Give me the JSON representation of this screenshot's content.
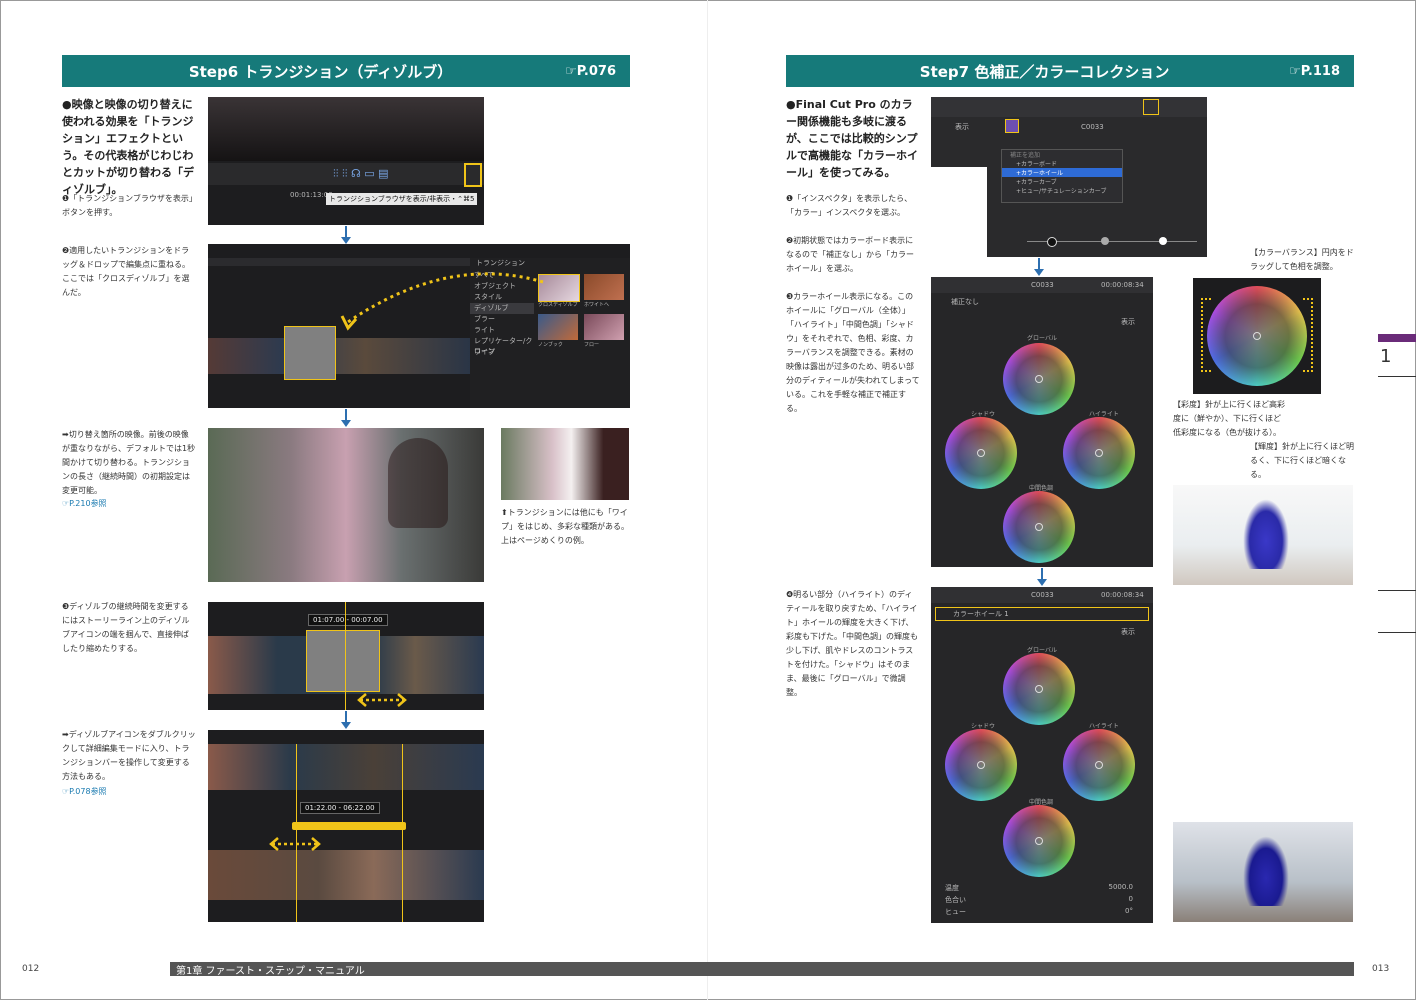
{
  "left": {
    "banner_title": "Step6 トランジション（ディゾルブ）",
    "banner_ref": "☞P.076",
    "lead": "●映像と映像の切り替えに使われる効果を「トランジション」エフェクトという。その代表格がじわじわとカットが切り替わる「ディゾルブ」。",
    "note1": "❶「トランジションブラウザを表示」ボタンを押す。",
    "tooltip": "トランジションブラウザを表示/非表示・⌃⌘5",
    "timecode1": "00:01:13:00",
    "note2": "❷適用したいトランジションをドラッグ＆ドロップで編集点に重ねる。ここでは「クロスディゾルブ」を選んだ。",
    "browser_header": "トランジション",
    "browser_items": [
      "すべて",
      "オブジェクト",
      "スタイル",
      "ディゾルブ",
      "ブラー",
      "ライト",
      "レプリケーター/クローン",
      "ワイプ"
    ],
    "thumb_labels": [
      "クロスディゾルブ",
      "ホワイトへ",
      "ノンブック",
      "フロー"
    ],
    "note3": "➡切り替え箇所の映像。前後の映像が重なりながら、デフォルトでは1秒間かけて切り替わる。トランジションの長さ（継続時間）の初期設定は変更可能。",
    "ref3": "☞P.210参照",
    "caption_small": "⬆トランジションには他にも「ワイプ」をはじめ、多彩な種類がある。上はページめくりの例。",
    "note4": "❸ディゾルブの継続時間を変更するにはストーリーライン上のディゾルブアイコンの端を掴んで、直接伸ばしたり縮めたりする。",
    "duration1": "01:07.00 - 00:07.00",
    "note5": "➡ディゾルブアイコンをダブルクリックして詳細編集モードに入り、トランジションバーを操作して変更する方法もある。",
    "ref5": "☞P.078参照",
    "duration2": "01:22.00 - 06:22.00",
    "page_number": "012",
    "footer": "第1章 ファースト・ステップ・マニュアル"
  },
  "right": {
    "banner_title": "Step7 色補正／カラーコレクション",
    "banner_ref": "☞P.118",
    "lead": "●Final Cut Pro のカラー関係機能も多岐に渡るが、ここでは比較的シンプルで高機能な「カラーホイール」を使ってみる。",
    "note1": "❶「インスペクタ」を表示したら、「カラー」インスペクタを選ぶ。",
    "note2": "❷初期状態ではカラーボード表示になるので「補正なし」から「カラーホイール」を選ぶ。",
    "note3": "❸カラーホイール表示になる。このホイールに「グローバル（全体）」「ハイライト」「中間色調」「シャドウ」をそれぞれで、色相、彩度、カラーバランスを調整できる。素材の映像は露出が过多のため、明るい部分のディティールが失われてしまっている。これを手軽な補正で補正する。",
    "note4": "❹明るい部分（ハイライト）のディティールを取り戻すため、「ハイライト」ホイールの輝度を大きく下げ、彩度も下げた。「中間色調」の輝度も少し下げ、肌やドレスのコントラストを付けた。「シャドウ」はそのまま、最後に「グローバル」で微調整。",
    "inspector_menu_header": "補正を追加",
    "inspector_menu": [
      "+カラーボード",
      "+カラーホイール",
      "+カラーカーブ",
      "+ヒュー/サチュレーションカーブ"
    ],
    "inspector_clip": "C0033",
    "inspector_time": "00:00:08:34",
    "preset_none": "補正なし",
    "preset_wheel": "カラーホイール 1",
    "view_label": "表示",
    "wheel_labels": [
      "グローバル",
      "シャドウ",
      "ハイライト",
      "中間色調"
    ],
    "params": [
      {
        "label": "温度",
        "value": "5000.0"
      },
      {
        "label": "色合い",
        "value": "0"
      },
      {
        "label": "ヒュー",
        "value": "0°"
      }
    ],
    "callout1": "【カラーバランス】円内をドラッグして色相を調整。",
    "callout2": "【彩度】針が上に行くほど高彩度に（鮮やか）、下に行くほど低彩度になる（色が抜ける）。",
    "callout3": "【輝度】針が上に行くほど明るく、下に行くほど暗くなる。",
    "side_tab": "1",
    "page_number": "013"
  }
}
